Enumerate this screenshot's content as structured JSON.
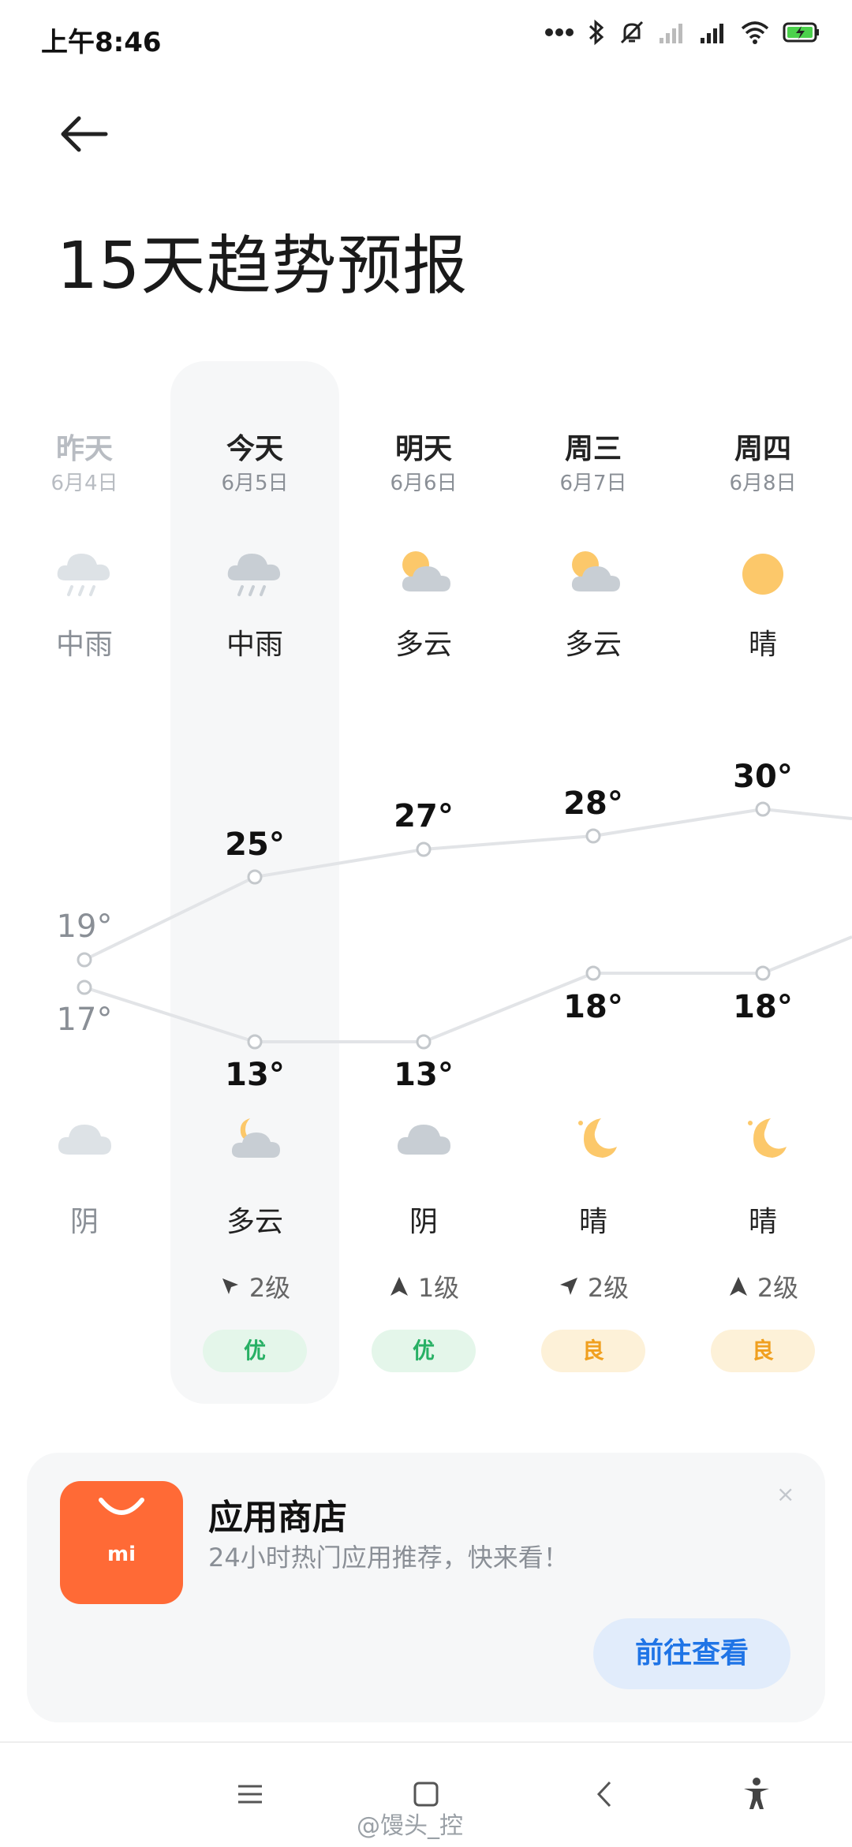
{
  "status": {
    "time": "上午8:46",
    "icons": [
      "more-icon",
      "bluetooth-icon",
      "mute-icon",
      "signal-off-icon",
      "signal-icon",
      "wifi-icon",
      "battery-charging-icon"
    ]
  },
  "header": {
    "title": "15天趋势预报"
  },
  "days": [
    {
      "name": "昨天",
      "date": "6月4日",
      "day_weather": "中雨",
      "day_icon": "rain-icon",
      "high": "19°",
      "low": "17°",
      "night_weather": "阴",
      "night_icon": "cloud-icon",
      "wind": "",
      "aqi": ""
    },
    {
      "name": "今天",
      "date": "6月5日",
      "day_weather": "中雨",
      "day_icon": "rain-icon",
      "high": "25°",
      "low": "13°",
      "night_weather": "多云",
      "night_icon": "cloudy-night-icon",
      "wind": "2级",
      "aqi": "优"
    },
    {
      "name": "明天",
      "date": "6月6日",
      "day_weather": "多云",
      "day_icon": "partly-cloudy-icon",
      "high": "27°",
      "low": "13°",
      "night_weather": "阴",
      "night_icon": "cloud-icon",
      "wind": "1级",
      "aqi": "优"
    },
    {
      "name": "周三",
      "date": "6月7日",
      "day_weather": "多云",
      "day_icon": "partly-cloudy-icon",
      "high": "28°",
      "low": "18°",
      "night_weather": "晴",
      "night_icon": "moon-icon",
      "wind": "2级",
      "aqi": "良"
    },
    {
      "name": "周四",
      "date": "6月8日",
      "day_weather": "晴",
      "day_icon": "sun-icon",
      "high": "30°",
      "low": "18°",
      "night_weather": "晴",
      "night_icon": "moon-icon",
      "wind": "2级",
      "aqi": "良"
    }
  ],
  "colors": {
    "aqi_good": "#27b064",
    "aqi_ok": "#f0a020",
    "sun": "#fcc86a",
    "cloud": "#c8ced4",
    "accent": "#1f74e6",
    "app": "#ff6a36"
  },
  "ad": {
    "title": "应用商店",
    "subtitle": "24小时热门应用推荐，快来看！",
    "button": "前往查看",
    "close": "×",
    "logo_text": "mi"
  },
  "watermark": "@馒头_控"
}
